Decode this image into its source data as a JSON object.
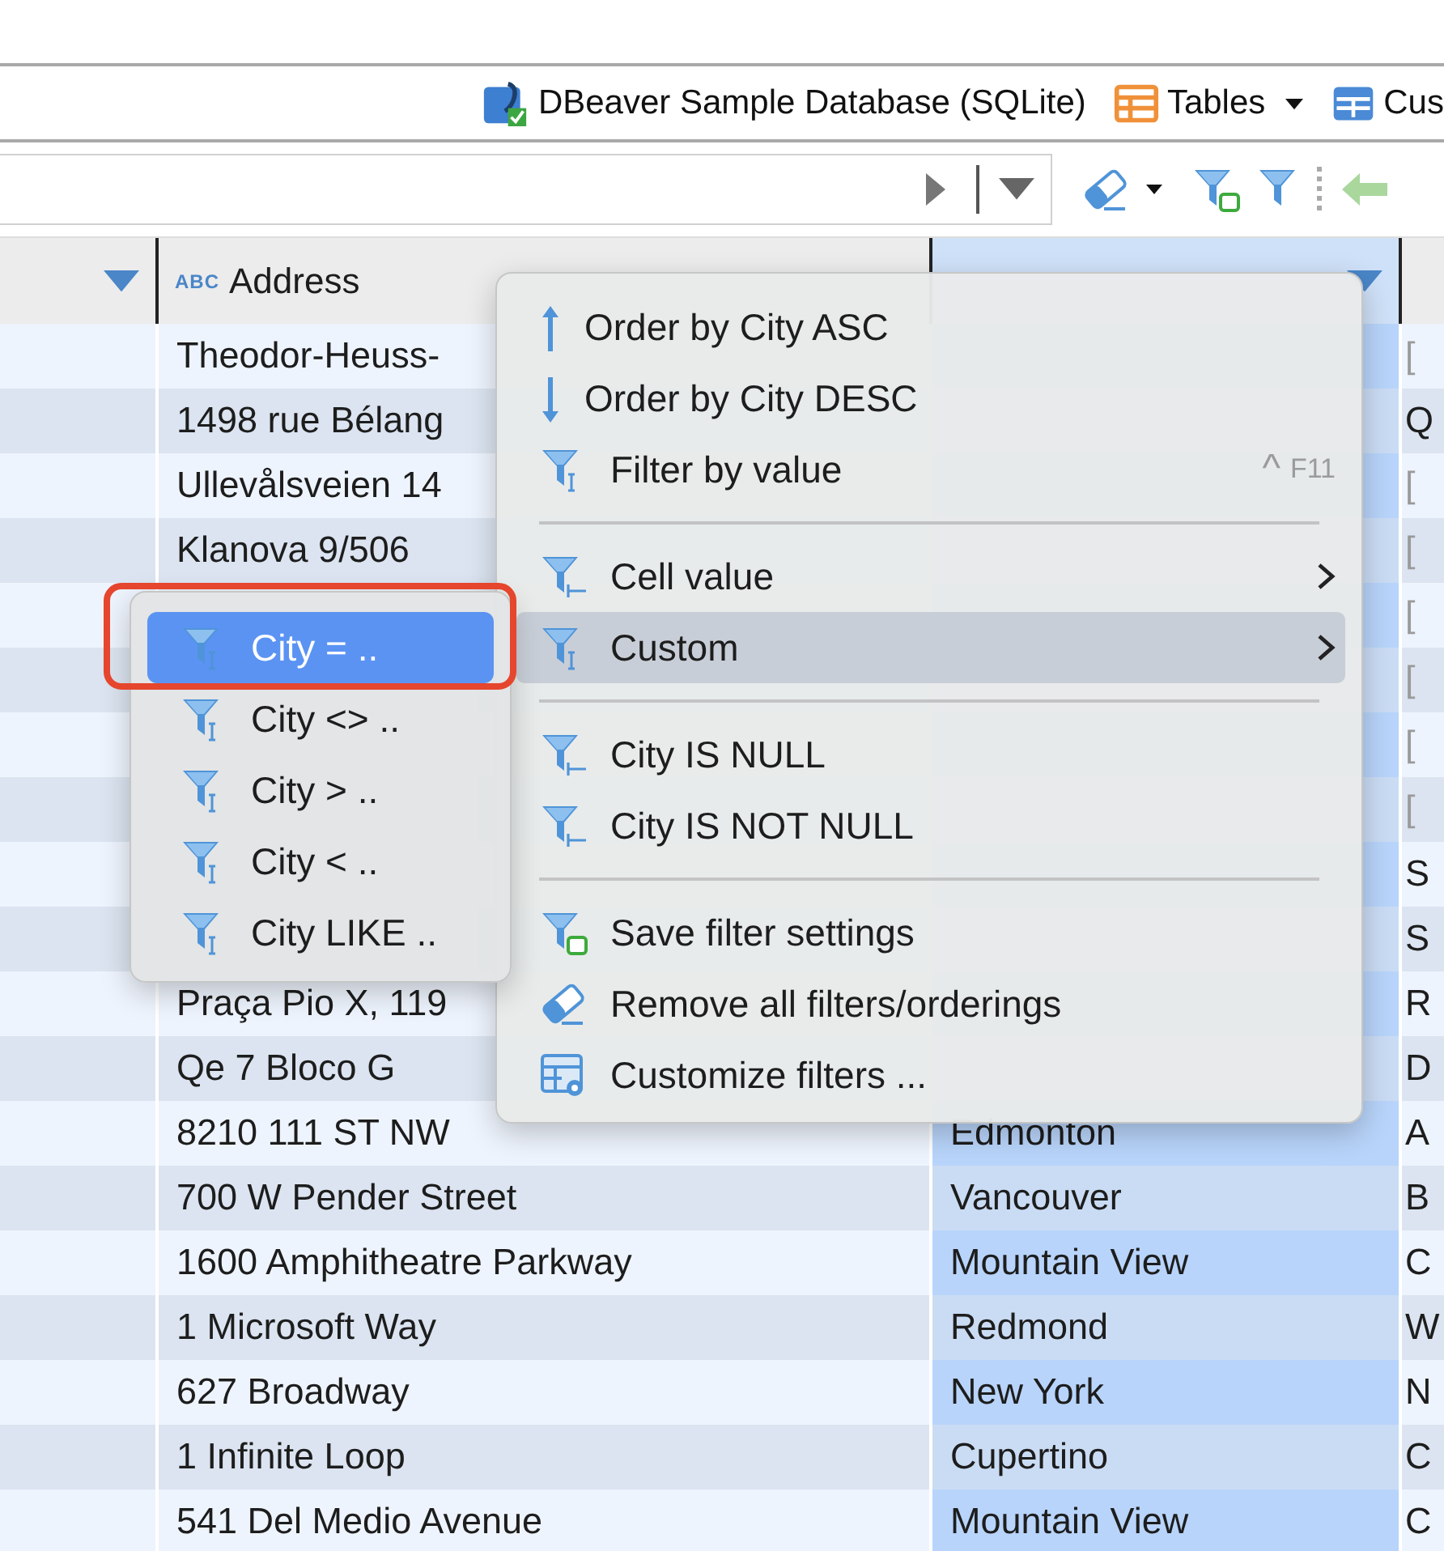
{
  "breadcrumbs": [
    {
      "label": "DBeaver Sample Database (SQLite)",
      "kind": "database",
      "dropdown": false
    },
    {
      "label": "Tables",
      "kind": "tables",
      "dropdown": true
    },
    {
      "label": "Cus",
      "kind": "table",
      "dropdown": false
    }
  ],
  "table": {
    "columns": [
      {
        "selected": false,
        "filter_arrow": true
      },
      {
        "label": "Address",
        "type_badge": "ABC",
        "selected": false,
        "filter_arrow": false
      },
      {
        "selected": true,
        "filter_arrow": true
      }
    ],
    "rows": [
      {
        "address": "Theodor-Heuss-",
        "column_4": "[",
        "is_null": true
      },
      {
        "address": "1498 rue Bélang",
        "column_4": "Q",
        "is_null": false
      },
      {
        "address": "Ullevålsveien 14",
        "column_4": "[",
        "is_null": true
      },
      {
        "address": "Klanova 9/506",
        "column_4": "[",
        "is_null": true
      },
      {
        "column_4": "[",
        "is_null": true
      },
      {
        "column_4": "[",
        "is_null": true
      },
      {
        "column_4": "[",
        "is_null": true
      },
      {
        "column_4": "[",
        "is_null": true
      },
      {
        "column_4": "S",
        "is_null": false
      },
      {
        "column_4": "S",
        "is_null": false
      },
      {
        "address": "Praça Pio X, 119",
        "column_4": "R",
        "is_null": false
      },
      {
        "address": "Qe 7 Bloco G",
        "column_4": "D",
        "is_null": false
      },
      {
        "address": "8210 111 ST NW",
        "city": "Edmonton",
        "column_4": "A",
        "is_null": false
      },
      {
        "address": "700 W Pender Street",
        "city": "Vancouver",
        "column_4": "B",
        "is_null": false
      },
      {
        "address": "1600 Amphitheatre Parkway",
        "city": "Mountain View",
        "column_4": "C",
        "is_null": false
      },
      {
        "address": "1 Microsoft Way",
        "city": "Redmond",
        "column_4": "W",
        "is_null": false
      },
      {
        "address": "627 Broadway",
        "city": "New York",
        "column_4": "N",
        "is_null": false
      },
      {
        "address": "1 Infinite Loop",
        "city": "Cupertino",
        "column_4": "C",
        "is_null": false
      },
      {
        "address": "541 Del Medio Avenue",
        "city": "Mountain View",
        "column_4": "C",
        "is_null": false
      }
    ]
  },
  "context_menu": {
    "items": [
      {
        "kind": "sort_asc",
        "label": "Order by City ASC",
        "submenu": false,
        "highlighted": false
      },
      {
        "kind": "sort_desc",
        "label": "Order by City DESC",
        "submenu": false,
        "highlighted": false
      },
      {
        "kind": "filter_text",
        "label": "Filter by value",
        "shortcut_key": "^",
        "shortcut": "F11",
        "submenu": false,
        "highlighted": false
      },
      {
        "kind": "separator"
      },
      {
        "kind": "filter_null",
        "label": "Cell value",
        "submenu": true,
        "highlighted": false
      },
      {
        "kind": "filter_text",
        "label": "Custom",
        "submenu": true,
        "highlighted": true
      },
      {
        "kind": "separator"
      },
      {
        "kind": "filter_null",
        "label": "City IS NULL",
        "submenu": false,
        "highlighted": false
      },
      {
        "kind": "filter_null",
        "label": "City IS NOT NULL",
        "submenu": false,
        "highlighted": false
      },
      {
        "kind": "separator"
      },
      {
        "kind": "filter_save",
        "label": "Save filter settings",
        "submenu": false,
        "highlighted": false
      },
      {
        "kind": "eraser",
        "label": "Remove all filters/orderings",
        "submenu": false,
        "highlighted": false
      },
      {
        "kind": "customize",
        "label": "Customize filters ...",
        "submenu": false,
        "highlighted": false
      }
    ]
  },
  "submenu": {
    "items": [
      {
        "label": "City = ..",
        "selected": true,
        "annotated": true
      },
      {
        "label": "City <> ..",
        "selected": false,
        "annotated": false
      },
      {
        "label": "City > ..",
        "selected": false,
        "annotated": false
      },
      {
        "label": "City < ..",
        "selected": false,
        "annotated": false
      },
      {
        "label": "City LIKE ..",
        "selected": false,
        "annotated": false
      }
    ]
  }
}
